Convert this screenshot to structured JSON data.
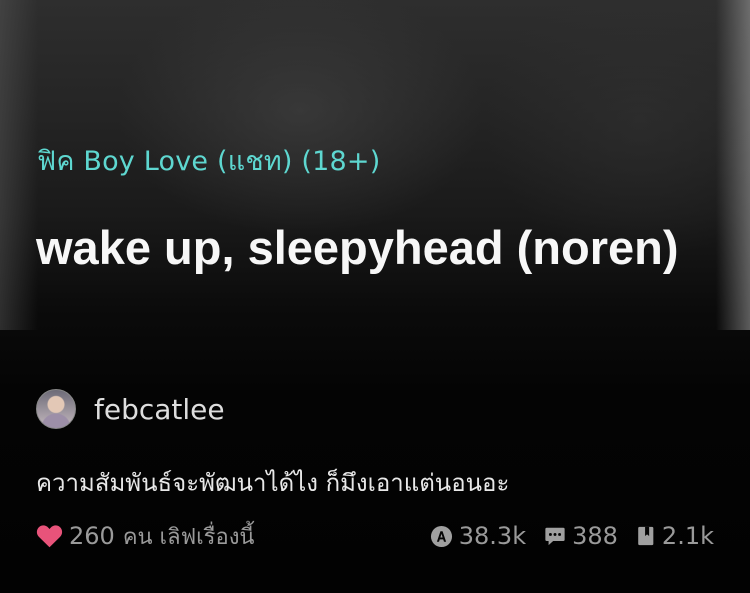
{
  "story": {
    "category": "ฟิค Boy Love (แชท) (18+)",
    "title": "wake up, sleepyhead (noren)",
    "author": "febcatlee",
    "description": "ความสัมพันธ์จะพัฒนาได้ไง  ก็มึงเอาแต่นอนอะ"
  },
  "stats": {
    "likes": "260",
    "likes_suffix": "คน เลิฟเรื่องนี้",
    "views": "38.3k",
    "comments": "388",
    "chapters": "2.1k"
  },
  "icons": {
    "likes": "heart-icon",
    "views": "views-icon",
    "comments": "comment-icon",
    "chapters": "book-icon"
  },
  "colors": {
    "category": "#5ed7d0",
    "heart": "#e8537a",
    "stat_text": "#9a9a9a",
    "title": "#f7f7f7"
  }
}
